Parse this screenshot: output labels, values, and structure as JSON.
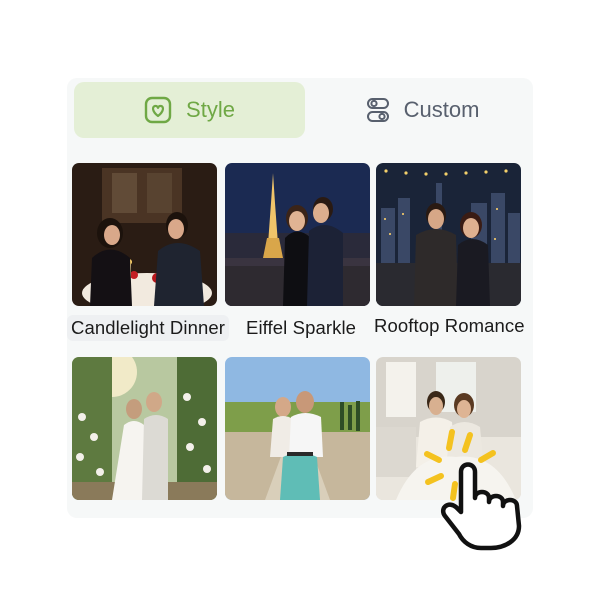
{
  "tabs": [
    {
      "label": "Style",
      "icon": "heart-frame-icon",
      "active": true
    },
    {
      "label": "Custom",
      "icon": "toggles-icon",
      "active": false
    }
  ],
  "styles": [
    {
      "label": "Candlelight Dinner",
      "image": "couple-candlelit-dinner-photo"
    },
    {
      "label": "Eiffel Sparkle",
      "image": "couple-eiffel-tower-night-photo"
    },
    {
      "label": "Rooftop Romance",
      "image": "couple-rooftop-city-night-photo"
    },
    {
      "label": "",
      "image": "couple-rose-garden-photo"
    },
    {
      "label": "",
      "image": "couple-scooter-countryside-photo"
    },
    {
      "label": "",
      "image": "couple-cozy-bed-photo"
    }
  ],
  "colors": {
    "accent": "#6fa845",
    "tab_active_bg": "#e4efd6",
    "tab_inactive_text": "#58606e"
  },
  "pointer": "tap-hand-icon"
}
